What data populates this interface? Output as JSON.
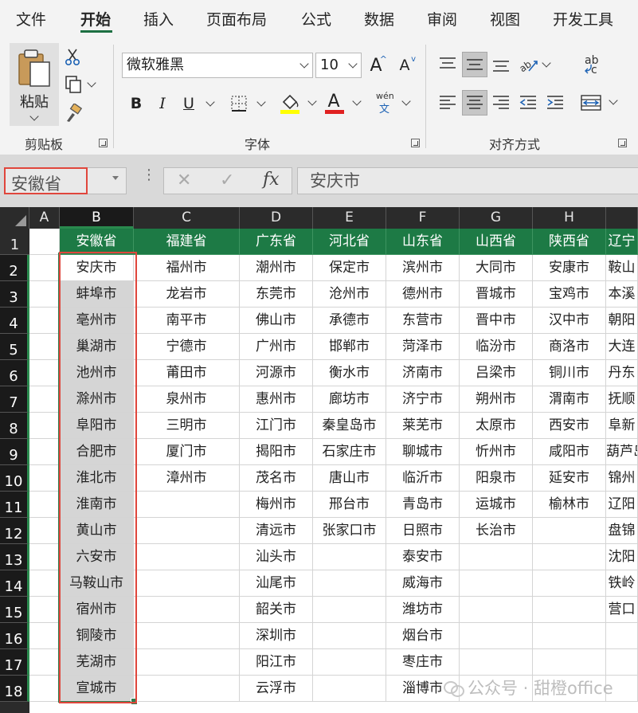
{
  "tabs": [
    "文件",
    "开始",
    "插入",
    "页面布局",
    "公式",
    "数据",
    "审阅",
    "视图",
    "开发工具"
  ],
  "active_tab": "开始",
  "ribbon": {
    "clipboard": {
      "paste_label": "粘贴",
      "group_label": "剪贴板"
    },
    "font": {
      "font_name": "微软雅黑",
      "font_size": "10",
      "grow_label": "A",
      "shrink_label": "A",
      "bold": "B",
      "italic": "I",
      "underline": "U",
      "font_color_label": "A",
      "phonetic_top": "wén",
      "phonetic_bottom": "文",
      "group_label": "字体"
    },
    "alignment": {
      "wrap_top": "ab",
      "wrap_bottom": "c",
      "group_label": "对齐方式"
    },
    "colors": {
      "fill_bar": "#ffff00",
      "font_bar": "#e02020",
      "accent": "#1d7a45"
    }
  },
  "namebox": {
    "value": "安徽省"
  },
  "formula": {
    "cancel": "✕",
    "confirm": "✓",
    "fx": "fx",
    "value": "安庆市"
  },
  "columns": [
    "A",
    "B",
    "C",
    "D",
    "E",
    "F",
    "G",
    "H",
    ""
  ],
  "rows": [
    "1",
    "2",
    "3",
    "4",
    "5",
    "6",
    "7",
    "8",
    "9",
    "10",
    "11",
    "12",
    "13",
    "14",
    "15",
    "16",
    "17",
    "18"
  ],
  "header_row": [
    "安徽省",
    "福建省",
    "广东省",
    "河北省",
    "山东省",
    "山西省",
    "陕西省",
    "辽宁"
  ],
  "data": [
    [
      "安庆市",
      "福州市",
      "潮州市",
      "保定市",
      "滨州市",
      "大同市",
      "安康市",
      "鞍山"
    ],
    [
      "蚌埠市",
      "龙岩市",
      "东莞市",
      "沧州市",
      "德州市",
      "晋城市",
      "宝鸡市",
      "本溪"
    ],
    [
      "亳州市",
      "南平市",
      "佛山市",
      "承德市",
      "东营市",
      "晋中市",
      "汉中市",
      "朝阳"
    ],
    [
      "巢湖市",
      "宁德市",
      "广州市",
      "邯郸市",
      "菏泽市",
      "临汾市",
      "商洛市",
      "大连"
    ],
    [
      "池州市",
      "莆田市",
      "河源市",
      "衡水市",
      "济南市",
      "吕梁市",
      "铜川市",
      "丹东"
    ],
    [
      "滁州市",
      "泉州市",
      "惠州市",
      "廊坊市",
      "济宁市",
      "朔州市",
      "渭南市",
      "抚顺"
    ],
    [
      "阜阳市",
      "三明市",
      "江门市",
      "秦皇岛市",
      "莱芜市",
      "太原市",
      "西安市",
      "阜新"
    ],
    [
      "合肥市",
      "厦门市",
      "揭阳市",
      "石家庄市",
      "聊城市",
      "忻州市",
      "咸阳市",
      "葫芦岛"
    ],
    [
      "淮北市",
      "漳州市",
      "茂名市",
      "唐山市",
      "临沂市",
      "阳泉市",
      "延安市",
      "锦州"
    ],
    [
      "淮南市",
      "",
      "梅州市",
      "邢台市",
      "青岛市",
      "运城市",
      "榆林市",
      "辽阳"
    ],
    [
      "黄山市",
      "",
      "清远市",
      "张家口市",
      "日照市",
      "长治市",
      "",
      "盘锦"
    ],
    [
      "六安市",
      "",
      "汕头市",
      "",
      "泰安市",
      "",
      "",
      "沈阳"
    ],
    [
      "马鞍山市",
      "",
      "汕尾市",
      "",
      "威海市",
      "",
      "",
      "铁岭"
    ],
    [
      "宿州市",
      "",
      "韶关市",
      "",
      "潍坊市",
      "",
      "",
      "营口"
    ],
    [
      "铜陵市",
      "",
      "深圳市",
      "",
      "烟台市",
      "",
      "",
      ""
    ],
    [
      "芜湖市",
      "",
      "阳江市",
      "",
      "枣庄市",
      "",
      "",
      ""
    ],
    [
      "宣城市",
      "",
      "云浮市",
      "",
      "淄博市",
      "",
      "",
      ""
    ]
  ],
  "watermark": "公众号 · 甜橙office"
}
